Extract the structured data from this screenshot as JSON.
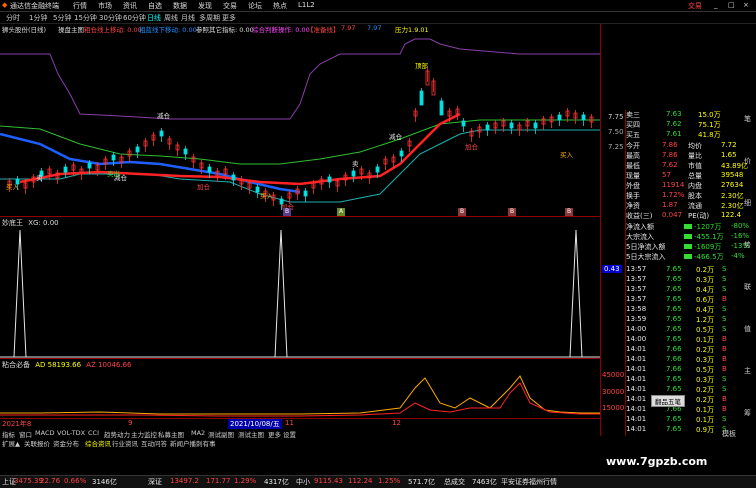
{
  "titlebar": {
    "app_name": "通达信金融终端",
    "menus": [
      "行情",
      "市场",
      "资讯",
      "自选",
      "数据",
      "发现",
      "交易",
      "论坛",
      "热点",
      "L1L2"
    ],
    "trade_label": "交易",
    "window_controls": [
      "_",
      "□",
      "×"
    ]
  },
  "periodbar": {
    "items": [
      "分时",
      "1分钟",
      "5分钟",
      "15分钟",
      "30分钟",
      "60分钟",
      "日线",
      "周线",
      "月线",
      "多周期",
      "更多"
    ],
    "selected": "日线"
  },
  "infoline": {
    "stock": "狮头股份(日线)",
    "main_indicator": "操盘主图",
    "upper": "粗仓线上移动: 0.00",
    "lower": "粗蓝线下移动: 0.00",
    "params": "参照其它指标: 0.00",
    "judge": "综合判断操作: 0.00",
    "signal_a": "【准备线】",
    "value_a": "7.97",
    "value_b": "7.97",
    "pressure": "压力1.9.01"
  },
  "main_chart": {
    "labels": [
      "减仓",
      "减仓",
      "卖",
      "减仓",
      "卖",
      "顶部",
      "加仓",
      "加仓",
      "加仓",
      "买入",
      "买入",
      "买入",
      "卖出"
    ],
    "price_axis": [
      "7.75",
      "7.50",
      "7.25"
    ],
    "x_markers": [
      "B",
      "A",
      "B",
      "B",
      "B"
    ]
  },
  "panel2": {
    "title": "妙底王",
    "value_label": "XG: 0.00",
    "side_value": "0.43"
  },
  "panel3": {
    "title": "粘合必备",
    "ad": "AD 58193.66",
    "az": "AZ 10046.66",
    "axis": [
      "45000",
      "30000",
      "15000"
    ]
  },
  "right_panel": {
    "quotes": [
      {
        "name": "卖三",
        "price": "7.63",
        "vol": "15.0万"
      },
      {
        "name": "买四",
        "price": "7.62",
        "vol": "75.1万"
      },
      {
        "name": "买五",
        "price": "7.61",
        "vol": "41.8万"
      }
    ],
    "stats": [
      {
        "k1": "今开",
        "v1": "7.86",
        "k2": "均价",
        "v2": "7.72"
      },
      {
        "k1": "最高",
        "v1": "7.86",
        "k2": "量比",
        "v2": "1.65"
      },
      {
        "k1": "最低",
        "v1": "7.62",
        "k2": "市值",
        "v2": "43.89亿"
      },
      {
        "k1": "现量",
        "v1": "57",
        "k2": "总量",
        "v2": "39548"
      },
      {
        "k1": "外盘",
        "v1": "11914",
        "k2": "内盘",
        "v2": "27634"
      },
      {
        "k1": "换手",
        "v1": "1.72%",
        "k2": "股本",
        "v2": "2.30亿"
      },
      {
        "k1": "净资",
        "v1": "1.87",
        "k2": "流通",
        "v2": "2.30亿"
      },
      {
        "k1": "收益(三)",
        "v1": "0.047",
        "k2": "PE(动)",
        "v2": "122.4"
      }
    ],
    "flows": [
      {
        "label": "净流入额",
        "value": "-1207万",
        "pct": "-80%"
      },
      {
        "label": "大宗流入",
        "value": "-455.1万",
        "pct": "-16%"
      },
      {
        "label": "5日净流入额",
        "value": "-1609万",
        "pct": "-13%"
      },
      {
        "label": "5日大宗流入",
        "value": "-466.5万",
        "pct": "-4%"
      }
    ],
    "ticks": [
      {
        "t": "13:57",
        "p": "7.65",
        "v": "0.2万",
        "d": "S"
      },
      {
        "t": "13:57",
        "p": "7.65",
        "v": "0.3万",
        "d": "S"
      },
      {
        "t": "13:57",
        "p": "7.65",
        "v": "0.4万",
        "d": "S"
      },
      {
        "t": "13:57",
        "p": "7.65",
        "v": "0.6万",
        "d": "B"
      },
      {
        "t": "13:58",
        "p": "7.65",
        "v": "0.4万",
        "d": "S"
      },
      {
        "t": "13:59",
        "p": "7.65",
        "v": "1.2万",
        "d": "S"
      },
      {
        "t": "14:00",
        "p": "7.65",
        "v": "0.5万",
        "d": "S"
      },
      {
        "t": "14:00",
        "p": "7.65",
        "v": "0.1万",
        "d": "B"
      },
      {
        "t": "14:01",
        "p": "7.66",
        "v": "0.2万",
        "d": "B"
      },
      {
        "t": "14:01",
        "p": "7.66",
        "v": "0.3万",
        "d": "B"
      },
      {
        "t": "14:01",
        "p": "7.66",
        "v": "0.5万",
        "d": "B"
      },
      {
        "t": "14:01",
        "p": "7.65",
        "v": "0.3万",
        "d": "S"
      },
      {
        "t": "14:01",
        "p": "7.65",
        "v": "0.2万",
        "d": "S"
      },
      {
        "t": "14:01",
        "p": "7.66",
        "v": "0.2万",
        "d": "B"
      },
      {
        "t": "14:01",
        "p": "7.66",
        "v": "0.1万",
        "d": "B"
      },
      {
        "t": "14:01",
        "p": "7.65",
        "v": "0.1万",
        "d": "S"
      },
      {
        "t": "14:01",
        "p": "7.65",
        "v": "0.9万",
        "d": "S"
      }
    ],
    "popup": "翻品五笔"
  },
  "bottom": {
    "dates": [
      "2021年8",
      "9",
      "2021/10/08/五",
      "11",
      "12"
    ],
    "tabs1": [
      "指标",
      "窗口",
      "MACD",
      "VOL-TDX",
      "CCI",
      "趋势动力",
      "主力监控",
      "私募主图",
      "MA2",
      "测试副图",
      "测试主图",
      "更多",
      "设置"
    ],
    "tabs2": [
      "扩展▲",
      "关联报价",
      "资金分布",
      "综合资讯",
      "行业资讯",
      "互动问答",
      "新闻户播刺有事"
    ],
    "right_tabs": [
      "笔",
      "价",
      "细",
      "势",
      "联",
      "值",
      "主",
      "筹"
    ],
    "sidebar_right_bottom": "模板"
  },
  "indexbar": {
    "items": [
      {
        "name": "上证",
        "value": "3475.39",
        "chg": "22.76",
        "pct": "0.66%",
        "amt": "3146亿"
      },
      {
        "name": "深证",
        "value": "13497.2",
        "chg": "171.77",
        "pct": "1.29%",
        "amt": "4317亿"
      },
      {
        "name": "中小",
        "value": "9115.43",
        "chg": "112.24",
        "pct": "1.25%",
        "amt": "571.7亿"
      },
      {
        "name": "总成交",
        "value": "7463亿"
      }
    ],
    "status": "平安证券福州行情"
  },
  "watermark": "www.7gpzb.com",
  "colors": {
    "up": "#ff4444",
    "down": "#33dd33",
    "ma_red": "#ff2222",
    "ma_blue": "#1e60ff",
    "purple": "#8a3fa8",
    "line_green": "#2fbf2f",
    "teal": "#1fb0b0"
  }
}
